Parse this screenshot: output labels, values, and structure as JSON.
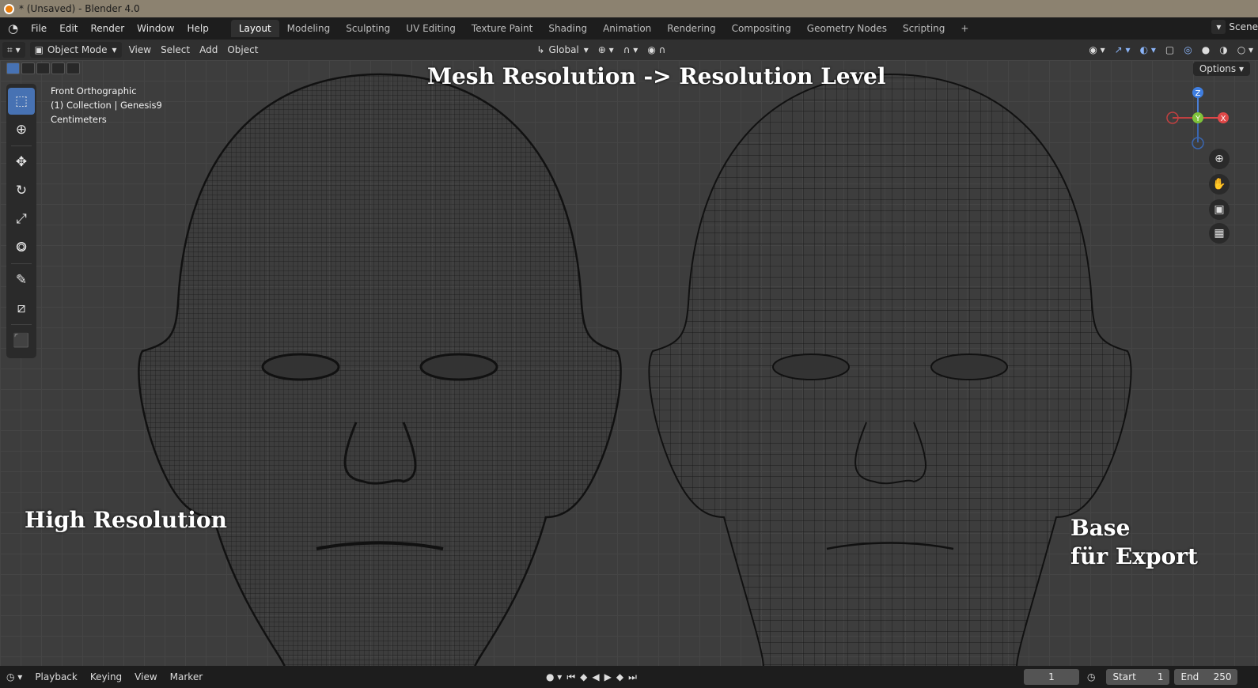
{
  "window": {
    "title": "* (Unsaved) - Blender 4.0"
  },
  "menu": {
    "items": [
      "File",
      "Edit",
      "Render",
      "Window",
      "Help"
    ]
  },
  "workspaces": {
    "tabs": [
      "Layout",
      "Modeling",
      "Sculpting",
      "UV Editing",
      "Texture Paint",
      "Shading",
      "Animation",
      "Rendering",
      "Compositing",
      "Geometry Nodes",
      "Scripting"
    ],
    "active": "Layout",
    "add_label": "+"
  },
  "scene": {
    "label": "Scene"
  },
  "header": {
    "mode": "Object Mode",
    "menus": [
      "View",
      "Select",
      "Add",
      "Object"
    ],
    "transform_orientation": "Global",
    "options_label": "Options"
  },
  "viewport_info": {
    "view_name": "Front Orthographic",
    "collection": "(1) Collection | Genesis9",
    "units": "Centimeters"
  },
  "annotations": {
    "heading": "Mesh Resolution -> Resolution Level",
    "left_label": "High Resolution",
    "right_label_line1": "Base",
    "right_label_line2": "für Export"
  },
  "gizmo": {
    "z": "Z",
    "y": "Y",
    "x": "X"
  },
  "timeline": {
    "menus": [
      "Playback",
      "Keying",
      "View",
      "Marker"
    ],
    "current_frame": "1",
    "start_label": "Start",
    "start_value": "1",
    "end_label": "End",
    "end_value": "250"
  },
  "colors": {
    "accent": "#4772b3",
    "titlebar": "#8c8270",
    "viewport_bg": "#3d3d3d",
    "wire": "#1a1a1a"
  },
  "icons": [
    "blender-logo-icon",
    "select-box-icon",
    "cursor-icon",
    "move-icon",
    "rotate-icon",
    "scale-icon",
    "transform-icon",
    "annotate-icon",
    "measure-icon",
    "add-cube-icon",
    "zoom-icon",
    "hand-icon",
    "camera-icon",
    "grid-icon"
  ]
}
